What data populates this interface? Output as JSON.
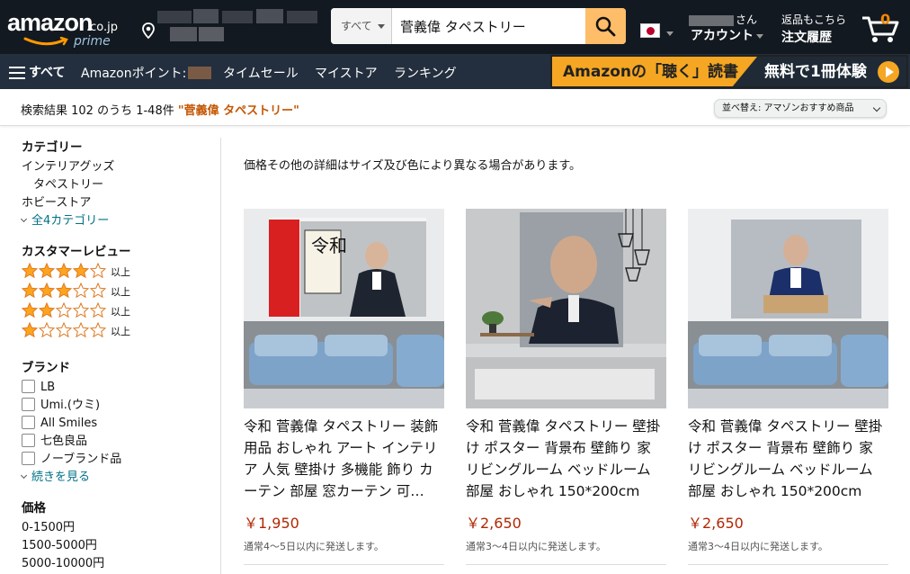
{
  "header": {
    "logo_text": "amazon",
    "logo_tld": ".co.jp",
    "logo_prime": "prime",
    "search_category": "すべて",
    "search_query": "菅義偉 タペストリー",
    "account_hello_suffix": "さん",
    "account_label": "アカウント",
    "orders_line1": "返品もこちら",
    "orders_line2": "注文履歴",
    "cart_count": "0"
  },
  "nav": {
    "all_label": "すべて",
    "points_label": "Amazonポイント:",
    "links": [
      "タイムセール",
      "マイストア",
      "ランキング"
    ],
    "banner_left": "Amazonの「聴く」読書",
    "banner_right": "無料で1冊体験"
  },
  "results": {
    "summary": "検索結果 102 のうち 1-48件 ",
    "query_quoted": "\"菅義偉 タペストリー\"",
    "sort_label": "並べ替え: アマゾンおすすめ商品"
  },
  "sidebar": {
    "category_heading": "カテゴリー",
    "categories": [
      "インテリアグッズ",
      "タペストリー",
      "ホビーストア"
    ],
    "all_categories": "全4カテゴリー",
    "review_heading": "カスタマーレビュー",
    "review_rows": [
      {
        "stars": 4,
        "label": "以上"
      },
      {
        "stars": 3,
        "label": "以上"
      },
      {
        "stars": 2,
        "label": "以上"
      },
      {
        "stars": 1,
        "label": "以上"
      }
    ],
    "brand_heading": "ブランド",
    "brands": [
      "LB",
      "Umi.(ウミ)",
      "All Smiles",
      "七色良品",
      "ノーブランド品"
    ],
    "see_more": "続きを見る",
    "price_heading": "価格",
    "price_ranges": [
      "0-1500円",
      "1500-5000円",
      "5000-10000円"
    ]
  },
  "main": {
    "price_note": "価格その他の詳細はサイズ及び色により異なる場合があります。",
    "products": [
      {
        "title": "令和 菅義偉 タペストリー 装飾用品 おしゃれ アート インテリア 人気 壁掛け 多機能 飾り カーテン 部屋 窓カーテン 可…",
        "price": "￥1,950",
        "shipping": "通常4～5日以内に発送します。",
        "poster_text": "令和"
      },
      {
        "title": "令和 菅義偉 タペストリー 壁掛け ポスター 背景布 壁飾り 家 リビングルーム ベッドルーム 部屋 おしゃれ 150*200cm",
        "price": "￥2,650",
        "shipping": "通常3～4日以内に発送します。"
      },
      {
        "title": "令和 菅義偉 タペストリー 壁掛け ポスター 背景布 壁飾り 家 リビングルーム ベッドルーム 部屋 おしゃれ 150*200cm",
        "price": "￥2,650",
        "shipping": "通常3～4日以内に発送します。"
      }
    ]
  },
  "colors": {
    "header_bg": "#131921",
    "nav_bg": "#232f3e",
    "search_button": "#febd69",
    "price": "#b12704",
    "link": "#007185",
    "query_highlight": "#c45500",
    "star": "#ffa41c"
  }
}
